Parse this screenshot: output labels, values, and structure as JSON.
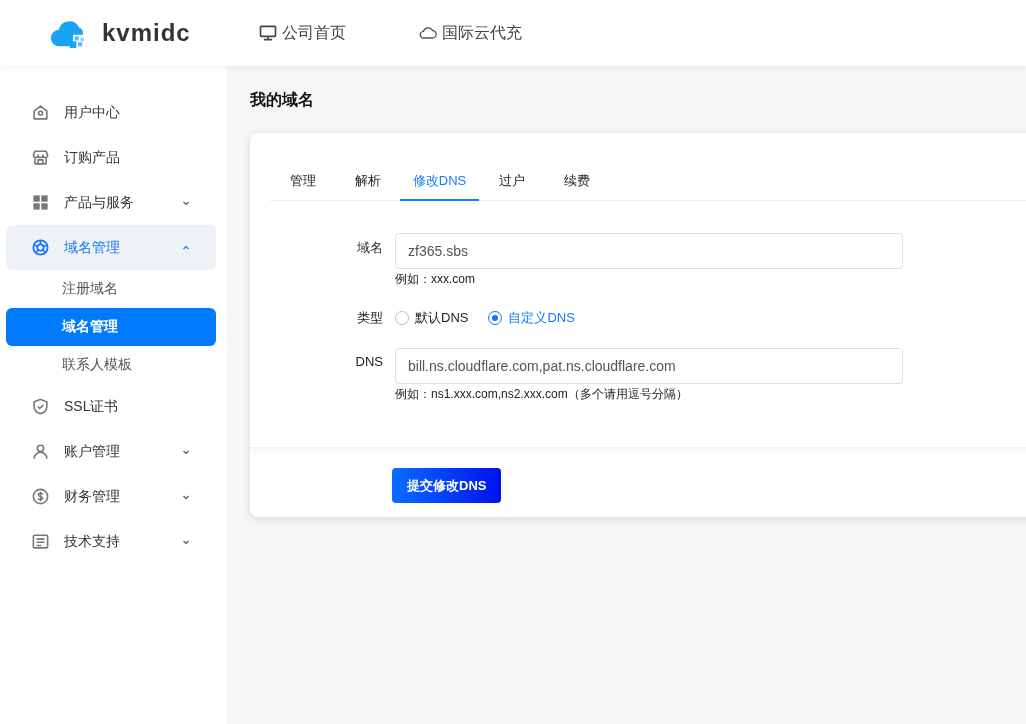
{
  "header": {
    "logo_text": "kvmidc",
    "nav": [
      {
        "label": "公司首页"
      },
      {
        "label": "国际云代充"
      }
    ]
  },
  "sidebar": {
    "items": [
      {
        "label": "用户中心",
        "kind": "item",
        "selected": false
      },
      {
        "label": "订购产品",
        "kind": "item",
        "selected": false
      },
      {
        "label": "产品与服务",
        "kind": "group",
        "selected": false,
        "expanded": false
      },
      {
        "label": "域名管理",
        "kind": "group",
        "selected": true,
        "expanded": true,
        "children": [
          {
            "label": "注册域名",
            "selected": false
          },
          {
            "label": "域名管理",
            "selected": true
          },
          {
            "label": "联系人模板",
            "selected": false
          }
        ]
      },
      {
        "label": "SSL证书",
        "kind": "item",
        "selected": false
      },
      {
        "label": "账户管理",
        "kind": "group",
        "selected": false,
        "expanded": false
      },
      {
        "label": "财务管理",
        "kind": "group",
        "selected": false,
        "expanded": false
      },
      {
        "label": "技术支持",
        "kind": "group",
        "selected": false,
        "expanded": false
      }
    ]
  },
  "page_title": "我的域名",
  "tabs": [
    {
      "label": "管理",
      "selected": false
    },
    {
      "label": "解析",
      "selected": false
    },
    {
      "label": "修改DNS",
      "selected": true
    },
    {
      "label": "过户",
      "selected": false
    },
    {
      "label": "续费",
      "selected": false
    }
  ],
  "form": {
    "fields": [
      {
        "kind": "text",
        "label": "域名",
        "value": "zf365.sbs",
        "hint": "例如：xxx.com"
      },
      {
        "kind": "radio",
        "label": "类型",
        "options": [
          {
            "label": "默认DNS",
            "selected": false
          },
          {
            "label": "自定义DNS",
            "selected": true
          }
        ]
      },
      {
        "kind": "text",
        "label": "DNS",
        "value": "bill.ns.cloudflare.com,pat.ns.cloudflare.com",
        "hint": "例如：ns1.xxx.com,ns2.xxx.com（多个请用逗号分隔）"
      }
    ],
    "submit": "提交修改DNS"
  }
}
